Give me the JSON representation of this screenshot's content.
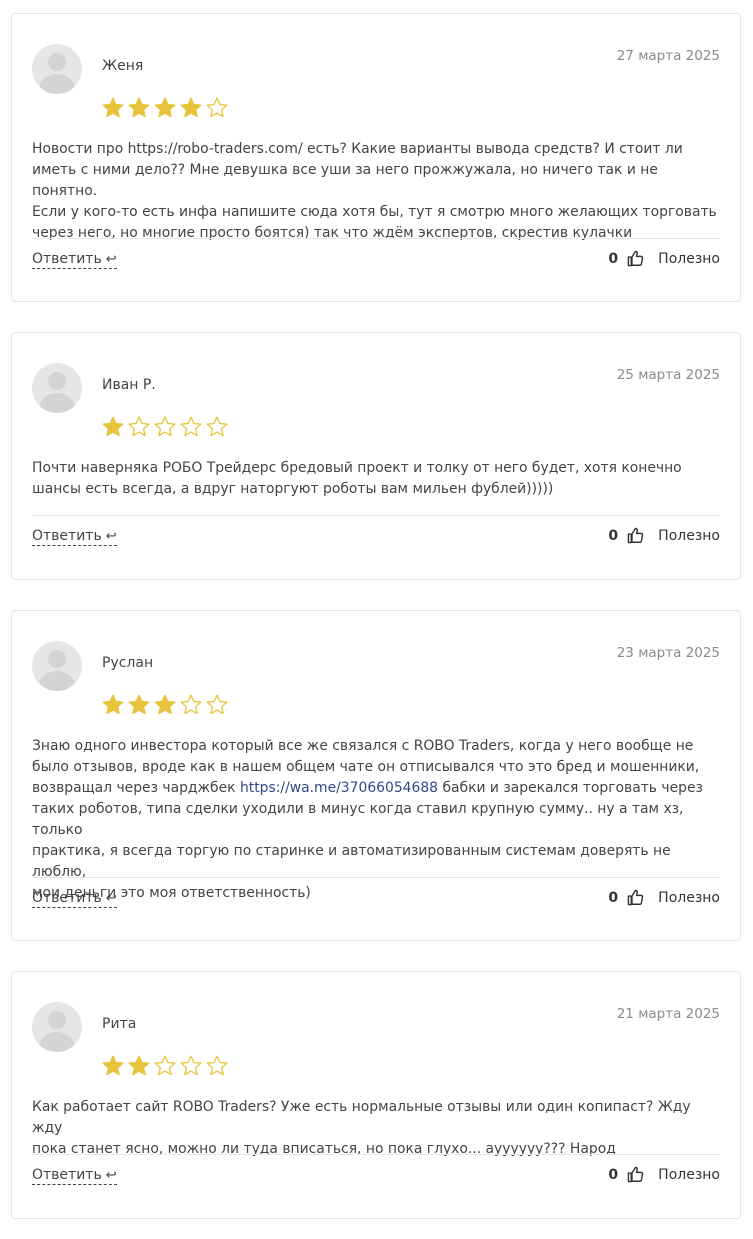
{
  "reply_label": "Ответить",
  "useful_label": "Полезно",
  "colors": {
    "star_filled": "#E8C43D",
    "star_empty": "#E8C43D",
    "link": "#2F4A8C"
  },
  "reviews": [
    {
      "name": "Женя",
      "date": "27 марта 2025",
      "rating": 4,
      "lines": [
        "Новости про https://robo-traders.com/ есть? Какие варианты вывода средств? И стоит ли",
        "иметь с ними дело?? Мне девушка все уши за него прожжужала, но ничего так и не понятно.",
        "Если у кого-то есть инфа напишите сюда хотя бы, тут я смотрю много желающих торговать",
        "через него, но многие просто боятся) так что ждём экспертов, скрестив кулачки"
      ],
      "likes": "0"
    },
    {
      "name": "Иван Р.",
      "date": "25 марта 2025",
      "rating": 1,
      "lines": [
        "Почти наверняка РОБО Трейдерс бредовый проект и толку от него будет, хотя конечно",
        "шансы есть всегда, а вдруг наторгуют роботы вам мильен фублей)))))"
      ],
      "likes": "0"
    },
    {
      "name": "Руслан",
      "date": "23 марта 2025",
      "rating": 3,
      "lines": [
        "Знаю одного инвестора который все же связался с ROBO Traders, когда у него вообще не",
        "было отзывов, вроде как в нашем общем чате он отписывался что это бред и мошенники,",
        "возвращал через чарджбек ",
        "таких роботов, типа сделки уходили в минус когда ставил крупную сумму.. ну а там хз, только",
        "практика, я всегда торгую по старинке и автоматизированным системам доверять не люблю,",
        "мои деньги это моя ответственность)"
      ],
      "link": "https://wa.me/37066054688",
      "line3_rest": " бабки и зарекался торговать через",
      "likes": "0"
    },
    {
      "name": "Рита",
      "date": "21 марта 2025",
      "rating": 2,
      "lines": [
        "Как работает сайт ROBO Traders? Уже есть нормальные отзывы или один копипаст? Жду жду",
        "пока станет ясно, можно ли туда вписаться, но пока глухо... ayyyyyy??? Народ"
      ],
      "likes": "0"
    }
  ]
}
